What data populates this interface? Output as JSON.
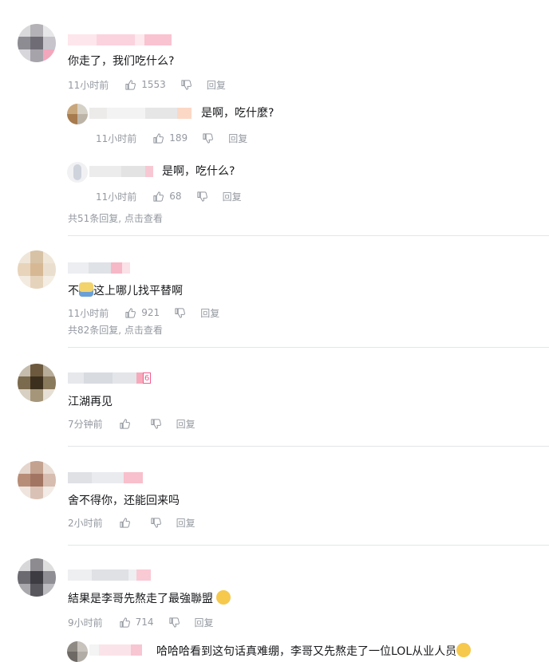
{
  "comments": [
    {
      "content": "你走了，我们吃什么?",
      "time": "11小时前",
      "likes": "1553",
      "reply_label": "回复",
      "replies": [
        {
          "content": "是啊，吃什麼?",
          "time": "11小时前",
          "likes": "189",
          "reply_label": "回复"
        },
        {
          "content": "是啊，吃什么?",
          "time": "11小时前",
          "likes": "68",
          "reply_label": "回复"
        }
      ],
      "more": "共51条回复, 点击查看"
    },
    {
      "content_pre": "不",
      "content_post": "这上哪儿找平替啊",
      "time": "11小时前",
      "likes": "921",
      "reply_label": "回复",
      "more": "共82条回复, 点击查看"
    },
    {
      "content": "江湖再见",
      "time": "7分钟前",
      "likes": "",
      "reply_label": "回复",
      "level_badge": "6"
    },
    {
      "content": "舍不得你，还能回来吗",
      "time": "2小时前",
      "likes": "",
      "reply_label": "回复"
    },
    {
      "content": "結果是李哥先熬走了最強聯盟",
      "time": "9小时前",
      "likes": "714",
      "reply_label": "回复",
      "replies": [
        {
          "content": "哈哈哈看到这句话真难绷，李哥又先熬走了一位LOL从业人员"
        }
      ]
    }
  ],
  "icons": {
    "like": "thumb-up-icon",
    "dislike": "thumb-down-icon"
  },
  "colors": {
    "meta": "#9499a0",
    "text": "#18191c",
    "divider": "#e3e5e7",
    "name_pink": "#fb7299"
  }
}
